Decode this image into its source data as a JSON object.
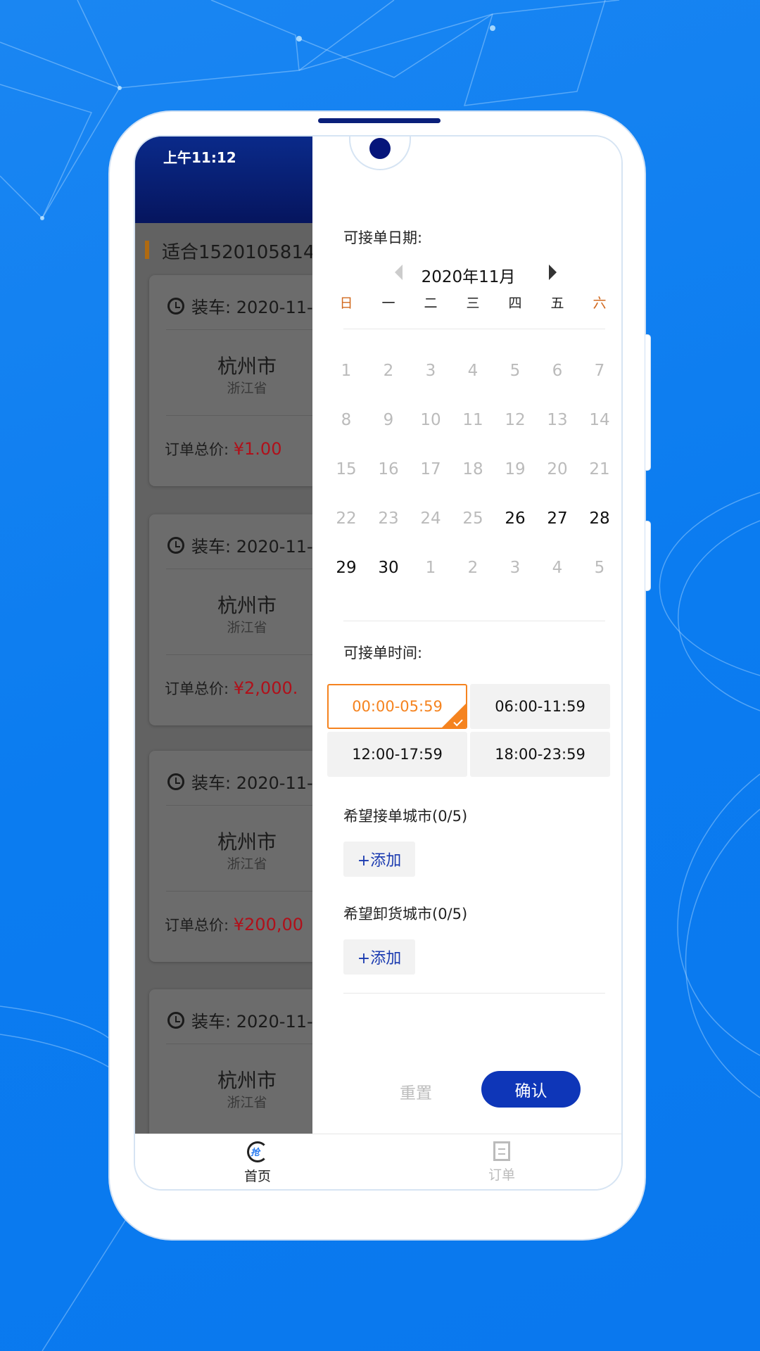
{
  "status_bar": {
    "time": "上午11:12"
  },
  "list": {
    "heading": "适合1520105814",
    "cards": [
      {
        "load": "装车: 2020-11-",
        "city": "杭州市",
        "province": "浙江省",
        "price_label": "订单总价:",
        "price": "¥1.00"
      },
      {
        "load": "装车: 2020-11-",
        "city": "杭州市",
        "province": "浙江省",
        "price_label": "订单总价:",
        "price": "¥2,000."
      },
      {
        "load": "装车: 2020-11-",
        "city": "杭州市",
        "province": "浙江省",
        "price_label": "订单总价:",
        "price": "¥200,00"
      },
      {
        "load": "装车: 2020-11-",
        "city": "杭州市",
        "province": "浙江省",
        "price_label": "",
        "price": ""
      }
    ]
  },
  "filter": {
    "date_label": "可接单日期:",
    "month": "2020年11月",
    "weekdays": [
      "日",
      "一",
      "二",
      "三",
      "四",
      "五",
      "六"
    ],
    "weeks": [
      [
        "1",
        "2",
        "3",
        "4",
        "5",
        "6",
        "7"
      ],
      [
        "8",
        "9",
        "10",
        "11",
        "12",
        "13",
        "14"
      ],
      [
        "15",
        "16",
        "17",
        "18",
        "19",
        "20",
        "21"
      ],
      [
        "22",
        "23",
        "24",
        "25",
        "26",
        "27",
        "28"
      ],
      [
        "29",
        "30",
        "1",
        "2",
        "3",
        "4",
        "5"
      ]
    ],
    "enabled_days": [
      "26",
      "27",
      "28",
      "29",
      "30"
    ],
    "time_label": "可接单时间:",
    "time_slots": [
      {
        "label": "00:00-05:59",
        "selected": true
      },
      {
        "label": "06:00-11:59",
        "selected": false
      },
      {
        "label": "12:00-17:59",
        "selected": false
      },
      {
        "label": "18:00-23:59",
        "selected": false
      }
    ],
    "pickup_city_label": "希望接单城市(0/5)",
    "unload_city_label": "希望卸货城市(0/5)",
    "add_label": "+添加",
    "reset_label": "重置",
    "confirm_label": "确认"
  },
  "colors": {
    "accent": "#f5831f",
    "primary": "#0e36b8",
    "price": "#d8121c",
    "weekend": "#d2691e"
  },
  "bottom_nav": [
    {
      "label": "首页",
      "icon": "grab-order-icon",
      "active": true
    },
    {
      "label": "订单",
      "icon": "order-list-icon",
      "active": false
    }
  ]
}
